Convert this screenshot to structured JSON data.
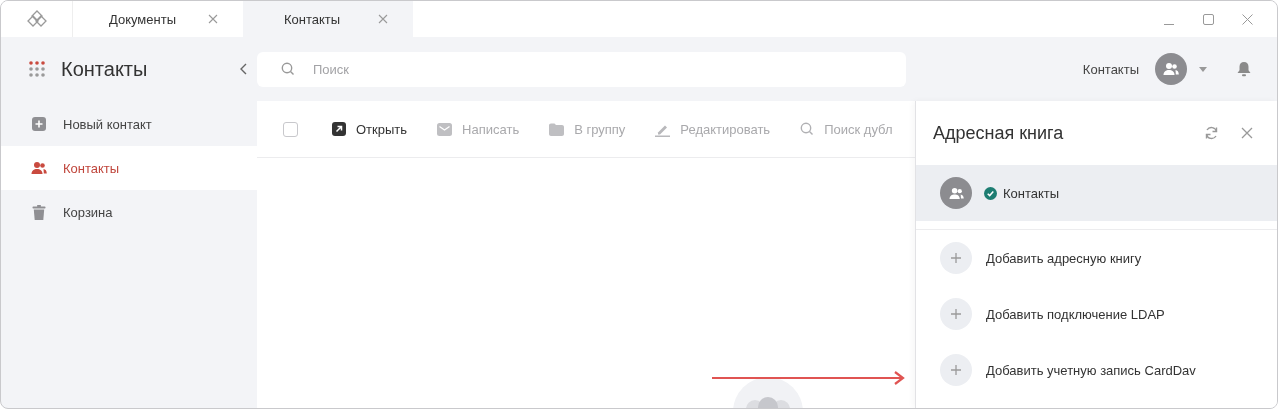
{
  "tabs": [
    {
      "label": "Документы",
      "selected": false
    },
    {
      "label": "Контакты",
      "selected": true
    }
  ],
  "sidebar": {
    "title": "Контакты",
    "items": [
      {
        "label": "Новый контакт",
        "kind": "plus",
        "selected": false
      },
      {
        "label": "Контакты",
        "kind": "people",
        "selected": true
      },
      {
        "label": "Корзина",
        "kind": "trash",
        "selected": false
      }
    ]
  },
  "search": {
    "placeholder": "Поиск"
  },
  "header": {
    "module_label": "Контакты"
  },
  "toolbar": {
    "select_all_checked": false,
    "actions": [
      {
        "label": "Открыть",
        "kind": "open",
        "disabled": false
      },
      {
        "label": "Написать",
        "kind": "mail",
        "disabled": true
      },
      {
        "label": "В группу",
        "kind": "folder",
        "disabled": true
      },
      {
        "label": "Редактировать",
        "kind": "edit",
        "disabled": true
      },
      {
        "label": "Поиск дубл",
        "kind": "search",
        "disabled": true
      }
    ]
  },
  "address_book_panel": {
    "title": "Адресная книга",
    "books": [
      {
        "name": "Контакты",
        "selected": true,
        "synced": true
      }
    ],
    "add_actions": [
      "Добавить адресную книгу",
      "Добавить подключение LDAP",
      "Добавить учетную запись CardDav"
    ]
  }
}
